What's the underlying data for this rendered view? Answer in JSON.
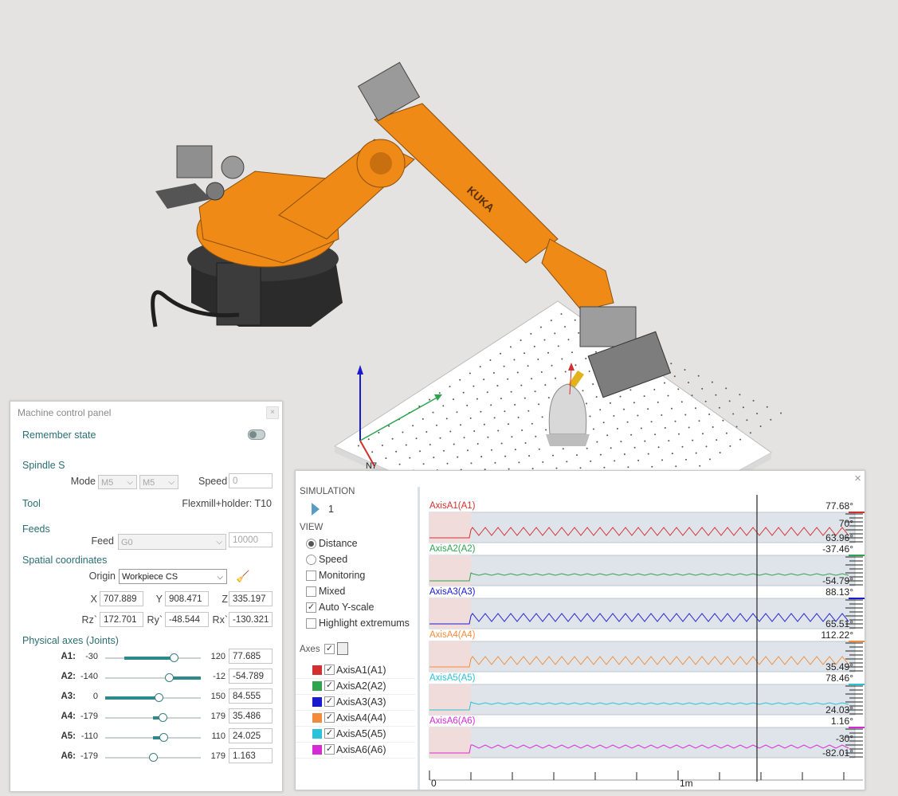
{
  "colors": {
    "orange": "#ef8a17",
    "accent": "#2a6e73"
  },
  "scene": {
    "robot_brand": "KUKA",
    "axis_label": "N7"
  },
  "machine_panel": {
    "title": "Machine control panel",
    "remember_state": "Remember state",
    "spindle": {
      "heading": "Spindle S",
      "mode_label": "Mode",
      "mode_value_1": "M5",
      "mode_value_2": "M5",
      "speed_label": "Speed",
      "speed_value": "0"
    },
    "tool": {
      "heading": "Tool",
      "value": "Flexmill+holder: T10"
    },
    "feeds": {
      "heading": "Feeds",
      "feed_label": "Feed",
      "feed_mode": "G0",
      "feed_value": "10000"
    },
    "spatial": {
      "heading": "Spatial coordinates",
      "origin_label": "Origin",
      "origin_value": "Workpiece CS",
      "x_label": "X",
      "x": "707.889",
      "y_label": "Y",
      "y": "908.471",
      "z_label": "Z",
      "z": "335.197",
      "rz_label": "Rz`",
      "rz": "172.701",
      "ry_label": "Ry`",
      "ry": "-48.544",
      "rx_label": "Rx`",
      "rx": "-130.321"
    },
    "joints_heading": "Physical axes (Joints)",
    "joints": [
      {
        "name": "A1:",
        "min": "-30",
        "max": "120",
        "value": "77.685",
        "level": 0.72
      },
      {
        "name": "A2:",
        "min": "-140",
        "max": "-12",
        "value": "-54.789",
        "level": 0.67
      },
      {
        "name": "A3:",
        "min": "0",
        "max": "150",
        "value": "84.555",
        "level": 0.56
      },
      {
        "name": "A4:",
        "min": "-179",
        "max": "179",
        "value": "35.486",
        "level": 0.6
      },
      {
        "name": "A5:",
        "min": "-110",
        "max": "110",
        "value": "24.025",
        "level": 0.61
      },
      {
        "name": "A6:",
        "min": "-179",
        "max": "179",
        "value": "1.163",
        "level": 0.5
      }
    ]
  },
  "simulation": {
    "heading": "SIMULATION",
    "run": "1",
    "view_heading": "VIEW",
    "options": {
      "distance": "Distance",
      "speed": "Speed",
      "monitoring": "Monitoring",
      "mixed": "Mixed",
      "auto_y": "Auto Y-scale",
      "highlight": "Highlight extremums"
    },
    "axes_heading": "Axes",
    "x_ticks": [
      "0",
      "1m"
    ]
  },
  "chart_data": {
    "type": "line",
    "x_ticks": [
      "0",
      "1m"
    ],
    "series": [
      {
        "name": "AxisA1(A1)",
        "color": "#d32f2f",
        "max": "77.68°",
        "mid": "70°",
        "min": "63.96°"
      },
      {
        "name": "AxisA2(A2)",
        "color": "#2ea44f",
        "max": "-37.46°",
        "mid": "",
        "min": "-54.79°"
      },
      {
        "name": "AxisA3(A3)",
        "color": "#1a1ad0",
        "max": "88.13°",
        "mid": "",
        "min": "65.51°"
      },
      {
        "name": "AxisA4(A4)",
        "color": "#f28c3c",
        "max": "112.22°",
        "mid": "",
        "min": "35.49°"
      },
      {
        "name": "AxisA5(A5)",
        "color": "#29c2d8",
        "max": "78.46°",
        "mid": "",
        "min": "24.03°"
      },
      {
        "name": "AxisA6(A6)",
        "color": "#d62ad6",
        "max": "1.16°",
        "mid": "-30°",
        "min": "-82.01°"
      }
    ]
  }
}
